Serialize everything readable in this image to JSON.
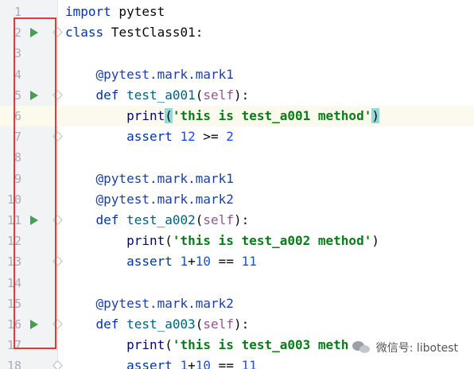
{
  "editor": {
    "lines": [
      {
        "number": "1",
        "tokens": [
          {
            "t": "import",
            "c": "kw"
          },
          {
            "t": " pytest",
            "c": ""
          }
        ]
      },
      {
        "number": "2",
        "run": true,
        "fold": true,
        "tokens": [
          {
            "t": "class",
            "c": "kw"
          },
          {
            "t": " TestClass01:",
            "c": ""
          }
        ]
      },
      {
        "number": "3",
        "tokens": []
      },
      {
        "number": "4",
        "tokens": [
          {
            "t": "    @pytest.mark.mark1",
            "c": "dec"
          }
        ]
      },
      {
        "number": "5",
        "run": true,
        "fold": true,
        "tokens": [
          {
            "t": "    ",
            "c": ""
          },
          {
            "t": "def",
            "c": "kw"
          },
          {
            "t": " ",
            "c": ""
          },
          {
            "t": "test_a001",
            "c": "fn"
          },
          {
            "t": "(",
            "c": ""
          },
          {
            "t": "self",
            "c": "self"
          },
          {
            "t": "):",
            "c": ""
          }
        ]
      },
      {
        "number": "6",
        "current": true,
        "tokens": [
          {
            "t": "        ",
            "c": ""
          },
          {
            "t": "print",
            "c": "bi"
          },
          {
            "t": "(",
            "c": "paren-hl"
          },
          {
            "t": "'this is test_a001 method'",
            "c": "str"
          },
          {
            "t": ")",
            "c": "paren-hl"
          }
        ]
      },
      {
        "number": "7",
        "fold": true,
        "tokens": [
          {
            "t": "        ",
            "c": ""
          },
          {
            "t": "assert",
            "c": "kw"
          },
          {
            "t": " ",
            "c": ""
          },
          {
            "t": "12",
            "c": "num"
          },
          {
            "t": " >= ",
            "c": ""
          },
          {
            "t": "2",
            "c": "num"
          }
        ]
      },
      {
        "number": "8",
        "tokens": []
      },
      {
        "number": "9",
        "tokens": [
          {
            "t": "    @pytest.mark.mark1",
            "c": "dec"
          }
        ]
      },
      {
        "number": "10",
        "tokens": [
          {
            "t": "    @pytest.mark.mark2",
            "c": "dec"
          }
        ]
      },
      {
        "number": "11",
        "run": true,
        "fold": true,
        "tokens": [
          {
            "t": "    ",
            "c": ""
          },
          {
            "t": "def",
            "c": "kw"
          },
          {
            "t": " ",
            "c": ""
          },
          {
            "t": "test_a002",
            "c": "fn"
          },
          {
            "t": "(",
            "c": ""
          },
          {
            "t": "self",
            "c": "self"
          },
          {
            "t": "):",
            "c": ""
          }
        ]
      },
      {
        "number": "12",
        "tokens": [
          {
            "t": "        ",
            "c": ""
          },
          {
            "t": "print",
            "c": "bi"
          },
          {
            "t": "(",
            "c": ""
          },
          {
            "t": "'this is test_a002 method'",
            "c": "str"
          },
          {
            "t": ")",
            "c": ""
          }
        ]
      },
      {
        "number": "13",
        "fold": true,
        "tokens": [
          {
            "t": "        ",
            "c": ""
          },
          {
            "t": "assert",
            "c": "kw"
          },
          {
            "t": " ",
            "c": ""
          },
          {
            "t": "1",
            "c": "num"
          },
          {
            "t": "+",
            "c": ""
          },
          {
            "t": "10",
            "c": "num"
          },
          {
            "t": " == ",
            "c": ""
          },
          {
            "t": "11",
            "c": "num"
          }
        ]
      },
      {
        "number": "14",
        "tokens": []
      },
      {
        "number": "15",
        "tokens": [
          {
            "t": "    @pytest.mark.mark2",
            "c": "dec"
          }
        ]
      },
      {
        "number": "16",
        "run": true,
        "fold": true,
        "tokens": [
          {
            "t": "    ",
            "c": ""
          },
          {
            "t": "def",
            "c": "kw"
          },
          {
            "t": " ",
            "c": ""
          },
          {
            "t": "test_a003",
            "c": "fn"
          },
          {
            "t": "(",
            "c": ""
          },
          {
            "t": "self",
            "c": "self"
          },
          {
            "t": "):",
            "c": ""
          }
        ]
      },
      {
        "number": "17",
        "tokens": [
          {
            "t": "        ",
            "c": ""
          },
          {
            "t": "print",
            "c": "bi"
          },
          {
            "t": "(",
            "c": ""
          },
          {
            "t": "'this is test_a003 meth",
            "c": "str"
          }
        ]
      },
      {
        "number": "18",
        "fold": true,
        "tokens": [
          {
            "t": "        ",
            "c": ""
          },
          {
            "t": "assert",
            "c": "kw"
          },
          {
            "t": " ",
            "c": ""
          },
          {
            "t": "1",
            "c": "num"
          },
          {
            "t": "+",
            "c": ""
          },
          {
            "t": "10",
            "c": "num"
          },
          {
            "t": " == ",
            "c": ""
          },
          {
            "t": "11",
            "c": "num"
          }
        ]
      }
    ]
  },
  "watermark": {
    "text": "微信号: libotest",
    "icon": "wechat-icon"
  },
  "colors": {
    "highlight_box": "#e23a3a",
    "run_icon": "#499c54",
    "keyword": "#0033b3",
    "string": "#067d17"
  }
}
